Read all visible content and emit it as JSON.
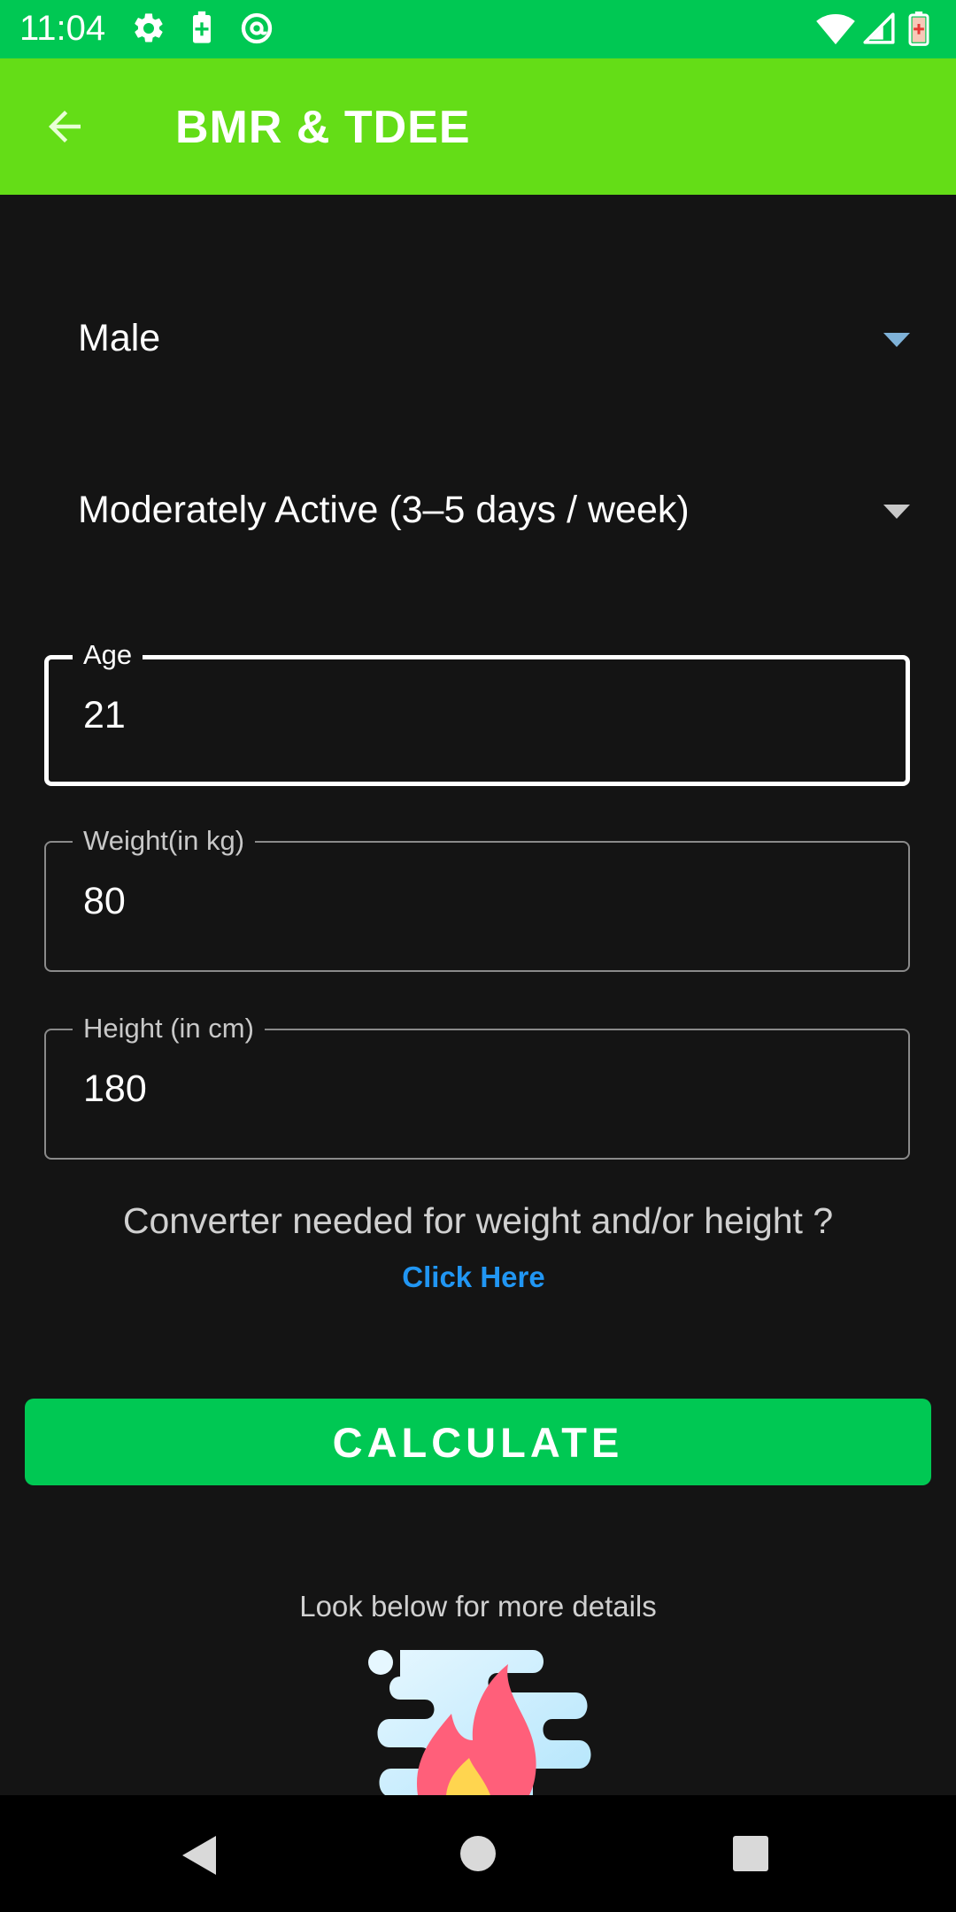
{
  "status_bar": {
    "time": "11:04",
    "left_icons": [
      "gear-icon",
      "battery-saver-icon",
      "at-sync-icon"
    ],
    "right_icons": [
      "wifi-icon",
      "cellular-signal-icon",
      "battery-low-icon"
    ]
  },
  "app_bar": {
    "title": "BMR & TDEE",
    "back_icon": "arrow-left-icon"
  },
  "form": {
    "gender": {
      "selected": "Male"
    },
    "activity": {
      "selected": "Moderately Active (3–5 days / week)"
    },
    "age": {
      "label": "Age",
      "value": "21"
    },
    "weight": {
      "label": "Weight(in kg)",
      "value": "80"
    },
    "height": {
      "label": "Height (in cm)",
      "value": "180"
    }
  },
  "converter": {
    "prompt": "Converter needed for weight and/or height ?",
    "link_label": "Click Here"
  },
  "calculate_label": "CALCULATE",
  "details_text": "Look below for more details",
  "colors": {
    "status_bar": "#00c853",
    "app_bar": "#64dd17",
    "background": "#141414",
    "button": "#00c853",
    "link": "#2196f3",
    "dropdown_arrow_active": "#7fb2d8"
  },
  "nav_bar": {
    "icons": [
      "nav-back-icon",
      "nav-home-icon",
      "nav-recents-icon"
    ]
  }
}
